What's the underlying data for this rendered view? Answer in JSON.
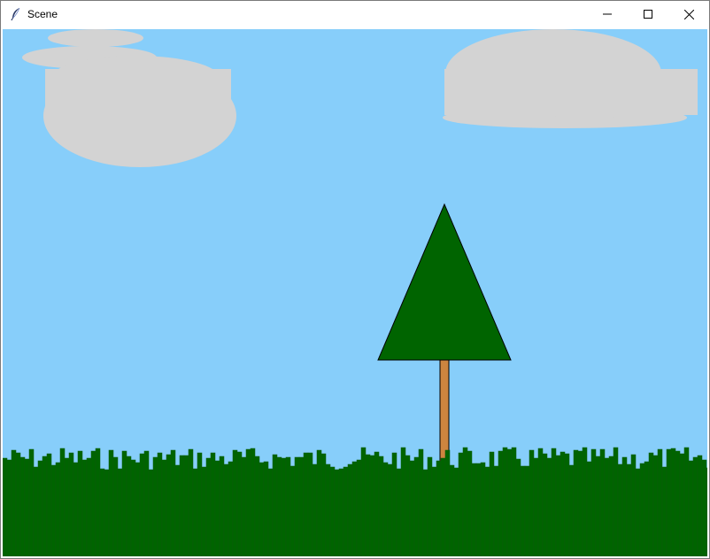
{
  "window": {
    "title": "Scene",
    "icon": "feather-icon",
    "controls": [
      "minimize-icon",
      "maximize-icon",
      "close-icon"
    ]
  },
  "scene": {
    "colors": {
      "sky": "#87cefa",
      "cloud": "#d3d3d3",
      "tree_foliage": "#006400",
      "tree_trunk": "#cd853f",
      "grass": "#006400"
    }
  }
}
